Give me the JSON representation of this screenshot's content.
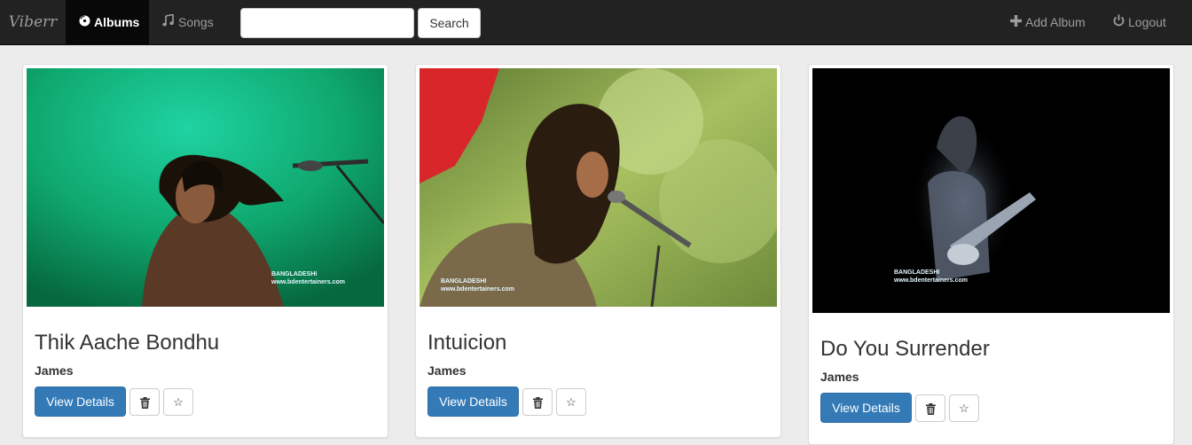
{
  "navbar": {
    "brand": "Viberr",
    "albums_label": "Albums",
    "songs_label": "Songs",
    "search_placeholder": "",
    "search_button": "Search",
    "add_album_label": "Add Album",
    "logout_label": "Logout",
    "background": "#222222",
    "active_background": "#080808"
  },
  "albums": [
    {
      "title": "Thik Aache Bondhu",
      "artist": "James",
      "view_label": "View Details",
      "watermark_brand": "BANGLADESHI",
      "watermark_url": "www.bdentertainers.com"
    },
    {
      "title": "Intuicion",
      "artist": "James",
      "view_label": "View Details",
      "watermark_brand": "BANGLADESHI",
      "watermark_url": "www.bdentertainers.com"
    },
    {
      "title": "Do You Surrender",
      "artist": "James",
      "view_label": "View Details",
      "watermark_brand": "BANGLADESHI",
      "watermark_url": "www.bdentertainers.com"
    }
  ],
  "icons": {
    "albums": "disc-icon",
    "songs": "music-note-icon",
    "add": "plus-icon",
    "logout": "power-icon",
    "delete": "trash-icon",
    "favorite": "star-icon"
  },
  "colors": {
    "primary": "#337ab7",
    "page_background": "#ececec"
  }
}
